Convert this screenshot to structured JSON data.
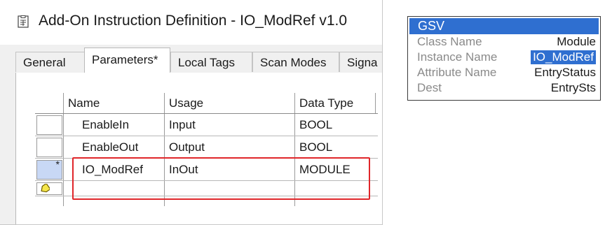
{
  "dialog": {
    "title": "Add-On Instruction Definition - IO_ModRef v1.0",
    "tabs": [
      {
        "label": "General"
      },
      {
        "label": "Parameters*"
      },
      {
        "label": "Local Tags"
      },
      {
        "label": "Scan Modes"
      },
      {
        "label": "Signa"
      }
    ],
    "active_tab": "Parameters*",
    "grid": {
      "columns": [
        "Name",
        "Usage",
        "Data Type"
      ],
      "rows": [
        {
          "marker": "",
          "name": "EnableIn",
          "usage": "Input",
          "data_type": "BOOL"
        },
        {
          "marker": "",
          "name": "EnableOut",
          "usage": "Output",
          "data_type": "BOOL"
        },
        {
          "marker": "*",
          "name": "IO_ModRef",
          "usage": "InOut",
          "data_type": "MODULE"
        },
        {
          "marker": "new-row-icon",
          "name": "",
          "usage": "",
          "data_type": ""
        }
      ]
    },
    "highlight_color": "#e0262a"
  },
  "gsv": {
    "title": "GSV",
    "accent_color": "#2f6fd0",
    "fields": [
      {
        "label": "Class Name",
        "value": "Module"
      },
      {
        "label": "Instance Name",
        "value": "IO_ModRef"
      },
      {
        "label": "Attribute Name",
        "value": "EntryStatus"
      },
      {
        "label": "Dest",
        "value": "EntrySts"
      }
    ]
  }
}
